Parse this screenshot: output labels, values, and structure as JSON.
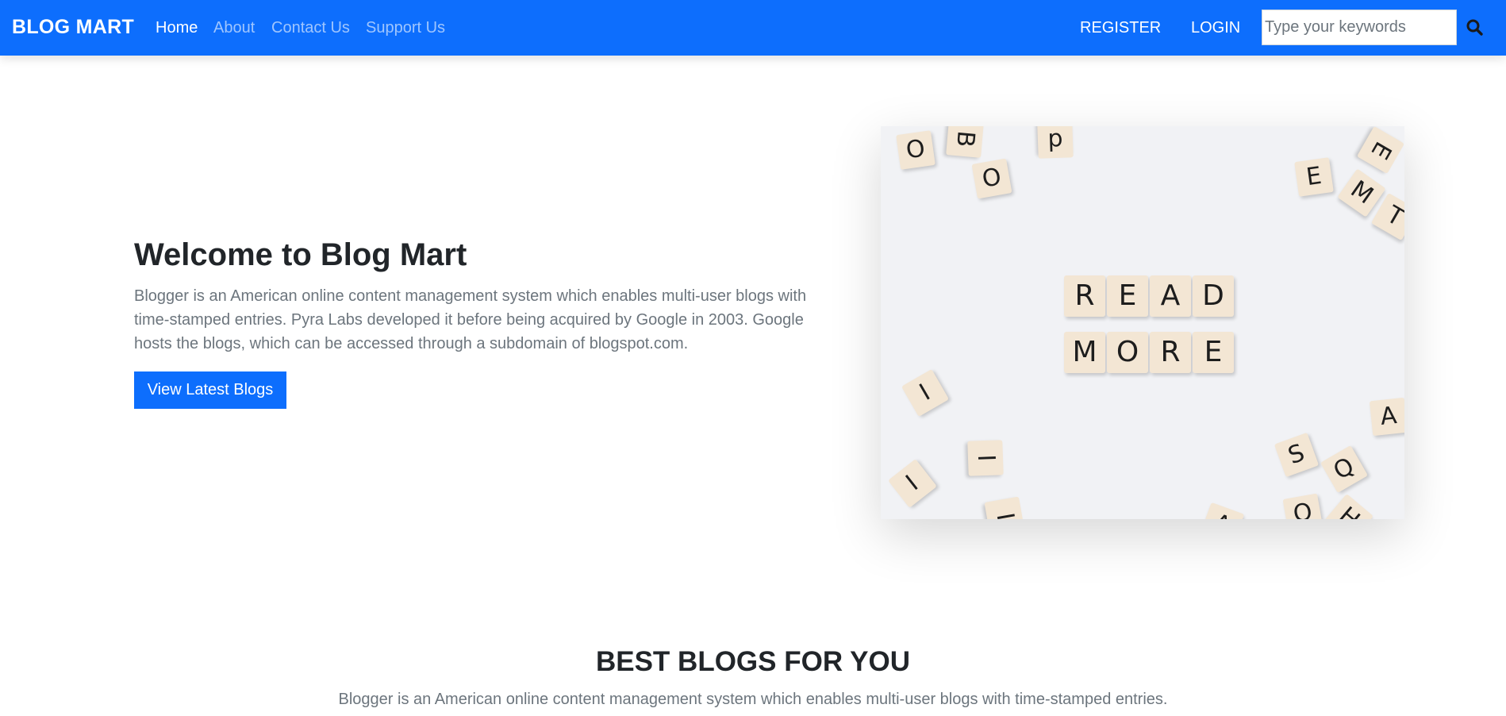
{
  "navbar": {
    "brand": "BLOG MART",
    "links": [
      "Home",
      "About",
      "Contact Us",
      "Support Us"
    ],
    "register": "REGISTER",
    "login": "LOGIN",
    "search_placeholder": "Type your keywords",
    "search_icon": "search-icon",
    "bg_color": "#0d6efd"
  },
  "hero": {
    "title": "Welcome to Blog Mart",
    "text": "Blogger is an American online content management system which enables multi-user blogs with time-stamped entries. Pyra Labs developed it before being acquired by Google in 2003. Google hosts the blogs, which can be accessed through a subdomain of blogspot.com.",
    "button": "View Latest Blogs"
  },
  "section": {
    "title": "BEST BLOGS FOR YOU",
    "subtitle": "Blogger is an American online content management system which enables multi-user blogs with time-stamped entries."
  }
}
